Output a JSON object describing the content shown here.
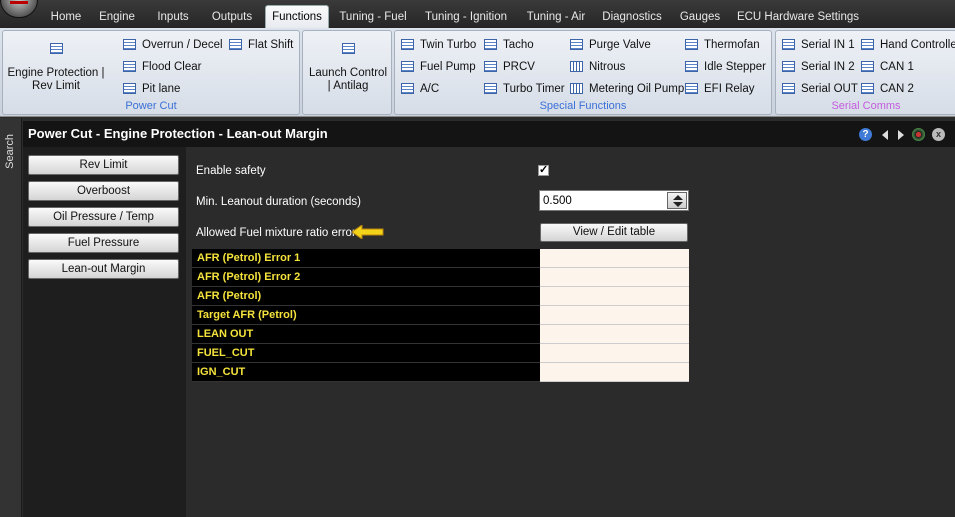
{
  "tabs": [
    "Home",
    "Engine",
    "Inputs",
    "Outputs",
    "Functions",
    "Tuning - Fuel",
    "Tuning - Ignition",
    "Tuning - Air",
    "Diagnostics",
    "Gauges",
    "ECU Hardware Settings"
  ],
  "ribbon": {
    "power_cut": {
      "title": "Power Cut",
      "engine_protection": "Engine Protection | Rev Limit",
      "overrun": "Overrun / Decel",
      "flat_shift": "Flat Shift",
      "flood_clear": "Flood Clear",
      "pit_lane": "Pit lane"
    },
    "launch": {
      "label": "Launch Control | Antilag"
    },
    "special": {
      "title": "Special Functions",
      "twin_turbo": "Twin Turbo",
      "tacho": "Tacho",
      "purge_valve": "Purge Valve",
      "thermofan": "Thermofan",
      "fuel_pump": "Fuel Pump",
      "prcv": "PRCV",
      "nitrous": "Nitrous",
      "idle_stepper": "Idle Stepper",
      "ac": "A/C",
      "turbo_timer": "Turbo Timer",
      "metering_oil_pump": "Metering Oil Pump",
      "efi_relay": "EFI Relay"
    },
    "serial": {
      "title": "Serial Comms",
      "serial_in_1": "Serial IN 1",
      "hand_controller": "Hand Controller",
      "serial_in_2": "Serial IN 2",
      "can_1": "CAN 1",
      "serial_out": "Serial OUT",
      "can_2": "CAN 2"
    }
  },
  "search_label": "Search",
  "page_title": "Power Cut - Engine Protection - Lean-out Margin",
  "help_label": "?",
  "close_label": "x",
  "side_menu": [
    "Rev Limit",
    "Overboost",
    "Oil Pressure / Temp",
    "Fuel Pressure",
    "Lean-out Margin"
  ],
  "form": {
    "enable_safety_label": "Enable safety",
    "enable_safety_checked": "✓",
    "min_leanout_label": "Min. Leanout duration (seconds)",
    "min_leanout_value": "0.500",
    "fuel_ratio_label": "Allowed Fuel mixture ratio error",
    "view_edit_button": "View / Edit table"
  },
  "table_rows": [
    "AFR (Petrol) Error 1",
    "AFR (Petrol) Error 2",
    "AFR (Petrol)",
    "Target AFR (Petrol)",
    "LEAN OUT",
    "FUEL_CUT",
    "IGN_CUT"
  ],
  "colors": {
    "accent_blue": "#3a6fd8",
    "serial_purple": "#c55be0",
    "row_text": "#f5e33c",
    "arrow": "#f3d21a"
  }
}
